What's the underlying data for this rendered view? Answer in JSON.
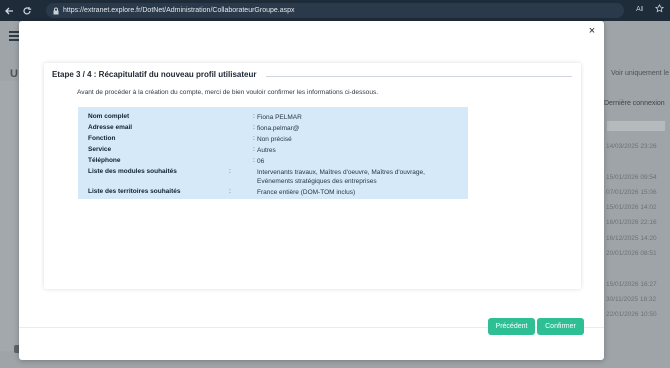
{
  "browser": {
    "url": "https://extranet.explore.fr/DotNet/Administration/CollaborateurGroupe.aspx",
    "back_icon": "back-arrow-icon",
    "reload_icon": "reload-icon"
  },
  "background": {
    "title_letter": "U",
    "voir_link": "Voir uniquement le",
    "column_header": "Dernière connexion",
    "dates": [
      "14/03/2025 23:26",
      "",
      "15/01/2026 09:54",
      "07/01/2026 15:06",
      "15/01/2026 14:02",
      "16/01/2026 22:16",
      "16/12/2025 14:20",
      "20/01/2026 08:51",
      "",
      "15/01/2026 16:27",
      "30/11/2025 18:32",
      "22/01/2026 10:50"
    ]
  },
  "modal": {
    "close_label": "×",
    "step_title": "Etape 3 / 4 : Récapitulatif du nouveau profil utilisateur",
    "intro": "Avant de procéder à la création du compte, merci de bien vouloir confirmer les informations ci-dessous.",
    "summary": [
      {
        "label": "Nom complet",
        "colon": ":",
        "value": "Fiona PELMAR"
      },
      {
        "label": "Adresse email",
        "colon": ":",
        "value": "fiona.pelmar@"
      },
      {
        "label": "Fonction",
        "colon": ":",
        "value": "Non précisé"
      },
      {
        "label": "Service",
        "colon": ":",
        "value": "Autres"
      },
      {
        "label": "Téléphone",
        "colon": ":",
        "value": "06"
      },
      {
        "label": "Liste des modules souhaités",
        "colon": ":",
        "value": "Intervenants travaux, Maîtres d'oeuvre, Maîtres d'ouvrage, Evénements stratégiques des entreprises"
      },
      {
        "label": "Liste des territoires souhaités",
        "colon": ":",
        "value": "France entière (DOM-TOM inclus)"
      }
    ],
    "buttons": {
      "previous": "Précédent",
      "confirm": "Confirmer"
    }
  },
  "colors": {
    "accent": "#2fbf94",
    "summary_bg": "#d5e9f8",
    "browser_bar": "#1e2b39"
  }
}
